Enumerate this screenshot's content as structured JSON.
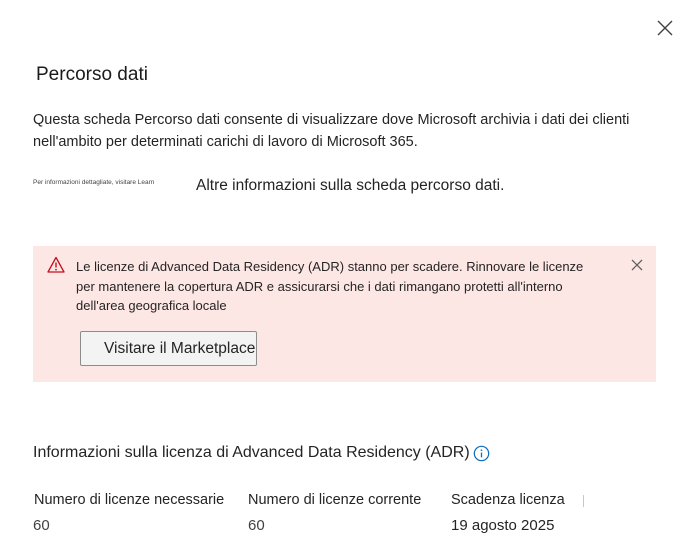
{
  "panel": {
    "title": "Percorso dati",
    "description": "Questa scheda Percorso dati consente di visualizzare dove Microsoft archivia i dati dei clienti nell'ambito per determinati carichi di lavoro di Microsoft 365.",
    "learn_small_text": "Per informazioni dettagliate, visitare Learn",
    "learn_link_text": "Altre informazioni sulla scheda percorso dati.",
    "close_icon": "close-icon"
  },
  "banner": {
    "message": "Le licenze di Advanced Data Residency (ADR) stanno per scadere. Rinnovare le licenze per mantenere la copertura ADR e assicurarsi che i dati rimangano protetti all'interno dell'area geografica locale",
    "button_label": "Visitare il Marketplace",
    "icon": "warning-icon",
    "background_color": "#fde7e4",
    "icon_color": "#c50f1f"
  },
  "license": {
    "section_title": "Informazioni sulla licenza di Advanced Data Residency (ADR)",
    "info_icon": "info-icon",
    "info_color": "#0f6cbd",
    "columns": [
      {
        "label": "Numero di licenze necessarie",
        "value": "60"
      },
      {
        "label": "Numero di licenze corrente",
        "value": "60"
      },
      {
        "label": "Scadenza licenza",
        "value": "19 agosto 2025"
      }
    ]
  }
}
